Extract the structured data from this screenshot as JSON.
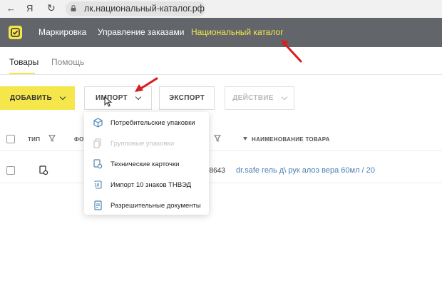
{
  "browser": {
    "back_glyph": "←",
    "ya_glyph": "Я",
    "reload_glyph": "↻",
    "url": "лк.национальный-каталог.рф"
  },
  "topnav": {
    "items": [
      {
        "label": "Маркировка"
      },
      {
        "label": "Управление заказами"
      },
      {
        "label": "Национальный каталог",
        "active": true
      }
    ],
    "accent_color": "#f4e64b"
  },
  "tabs": [
    {
      "label": "Товары",
      "active": true
    },
    {
      "label": "Помощь"
    }
  ],
  "toolbar": {
    "add_label": "ДОБАВИТЬ",
    "import_label": "ИМПОРТ",
    "export_label": "ЭКСПОРТ",
    "action_label": "ДЕЙСТВИЕ"
  },
  "import_menu": {
    "items": [
      {
        "label": "Потребительские упаковки",
        "icon": "box-icon",
        "disabled": false
      },
      {
        "label": "Групповые упаковки",
        "icon": "group-package-icon",
        "disabled": true
      },
      {
        "label": "Технические карточки",
        "icon": "tech-card-icon",
        "disabled": false
      },
      {
        "label": "Импорт 10 знаков ТНВЭД",
        "icon": "tnved-icon",
        "disabled": false
      },
      {
        "label": "Разрешительные документы",
        "icon": "document-icon",
        "disabled": false
      }
    ]
  },
  "table": {
    "headers": {
      "type": "ТИП",
      "photo": "ФОТ",
      "name": "НАИМЕНОВАНИЕ ТОВАРА"
    },
    "rows": [
      {
        "code_fragment": "38643",
        "name": "dr.safe гель д\\ рук алоэ вера 60мл / 20"
      }
    ]
  }
}
